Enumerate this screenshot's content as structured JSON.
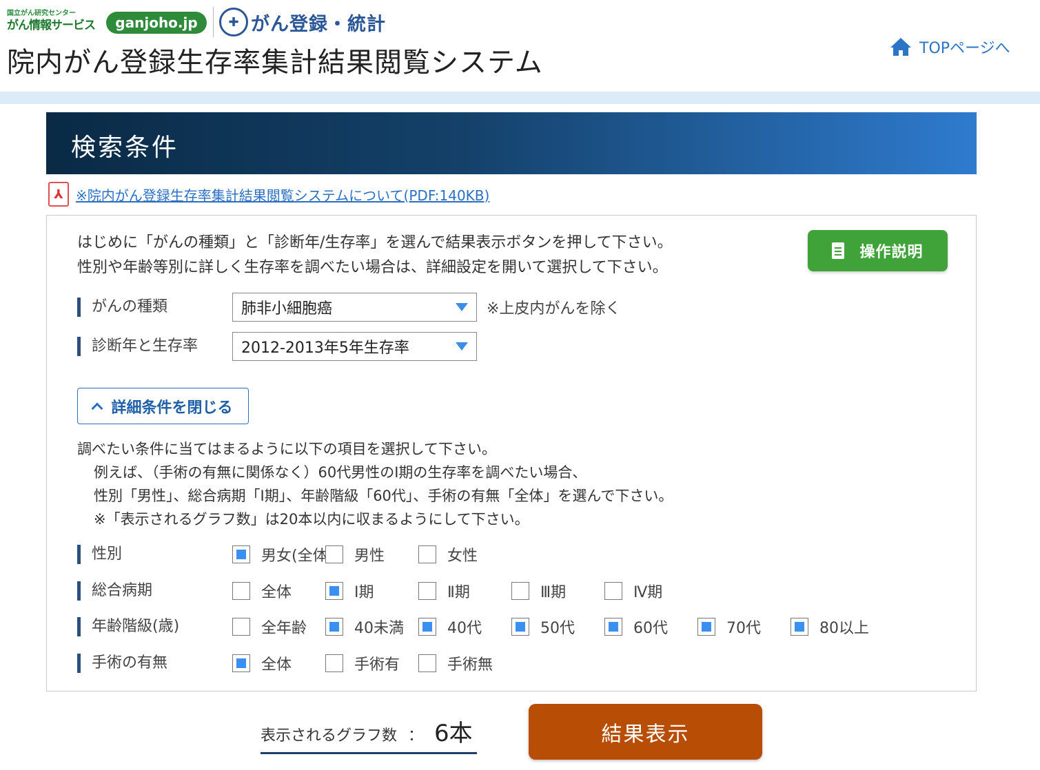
{
  "header": {
    "logo1_small": "国立がん研究センター",
    "logo1_main": "がん情報サービス",
    "logo_pill": "ganjoho.jp",
    "logo2_text": "がん登録・統計",
    "system_title": "院内がん登録生存率集計結果閲覧システム",
    "top_link": "TOPページへ"
  },
  "search": {
    "title": "検索条件",
    "pdf_link": "※院内がん登録生存率集計結果閲覧システムについて(PDF:140KB)",
    "intro_line1": "はじめに「がんの種類」と「診断年/生存率」を選んで結果表示ボタンを押して下さい。",
    "intro_line2": "性別や年齢等別に詳しく生存率を調べたい場合は、詳細設定を開いて選択して下さい。",
    "help_button": "操作説明",
    "cancer_type": {
      "label": "がんの種類",
      "value": "肺非小細胞癌",
      "note": "※上皮内がんを除く"
    },
    "diag_year": {
      "label": "診断年と生存率",
      "value": "2012-2013年5年生存率"
    },
    "detail_button": "詳細条件を閉じる",
    "detail_line1": "調べたい条件に当てはまるように以下の項目を選択して下さい。",
    "detail_line2": "例えば、（手術の有無に関係なく）60代男性のI期の生存率を調べたい場合、",
    "detail_line3": "性別「男性」、総合病期「I期」、年齢階級「60代」、手術の有無「全体」を選んで下さい。",
    "detail_line4": "※「表示されるグラフ数」は20本以内に収まるようにして下さい。"
  },
  "filters": {
    "sex": {
      "label": "性別",
      "options": [
        {
          "label": "男女(全体)",
          "checked": true
        },
        {
          "label": "男性",
          "checked": false
        },
        {
          "label": "女性",
          "checked": false
        }
      ]
    },
    "stage": {
      "label": "総合病期",
      "options": [
        {
          "label": "全体",
          "checked": false
        },
        {
          "label": "Ⅰ期",
          "checked": true
        },
        {
          "label": "Ⅱ期",
          "checked": false
        },
        {
          "label": "Ⅲ期",
          "checked": false
        },
        {
          "label": "Ⅳ期",
          "checked": false
        }
      ]
    },
    "age": {
      "label": "年齢階級(歳)",
      "options": [
        {
          "label": "全年齢",
          "checked": false
        },
        {
          "label": "40未満",
          "checked": true
        },
        {
          "label": "40代",
          "checked": true
        },
        {
          "label": "50代",
          "checked": true
        },
        {
          "label": "60代",
          "checked": true
        },
        {
          "label": "70代",
          "checked": true
        },
        {
          "label": "80以上",
          "checked": true
        }
      ]
    },
    "surgery": {
      "label": "手術の有無",
      "options": [
        {
          "label": "全体",
          "checked": true
        },
        {
          "label": "手術有",
          "checked": false
        },
        {
          "label": "手術無",
          "checked": false
        }
      ]
    }
  },
  "footer": {
    "count_label": "表示されるグラフ数",
    "count_sep": "：",
    "count_value": "6本",
    "result_button": "結果表示"
  }
}
